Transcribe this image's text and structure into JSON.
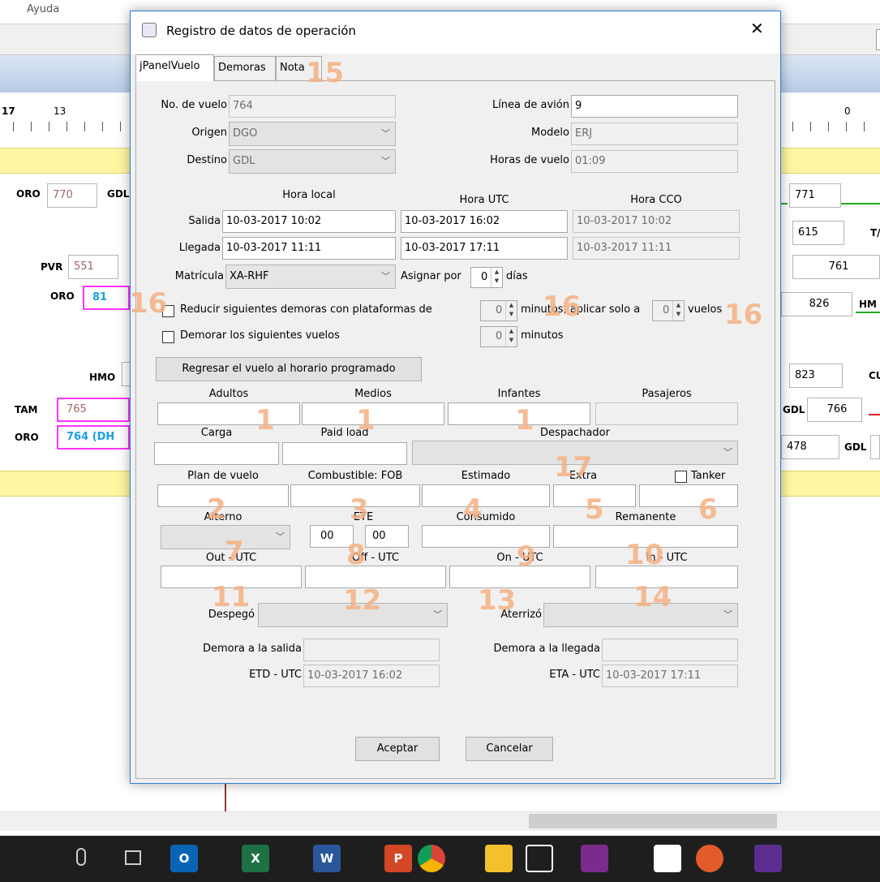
{
  "menu": {
    "help_label": "Ayuda"
  },
  "background": {
    "ruler": {
      "left_label": "17",
      "left_num": "13",
      "right_num": "0"
    },
    "left_rows": [
      {
        "code": "ORO",
        "num": "770",
        "dest": "GDL"
      },
      {
        "code": "PVR",
        "num": "551"
      },
      {
        "code": "ORO",
        "num": "81"
      },
      {
        "code": "HMO"
      },
      {
        "code": "TAM",
        "num": "765"
      },
      {
        "code": "ORO",
        "num": "764 (DH"
      }
    ],
    "right_rows": [
      {
        "num": "771"
      },
      {
        "num": "615",
        "code": "T/"
      },
      {
        "num": "761"
      },
      {
        "num": "826",
        "code": "HM"
      },
      {
        "num": "823",
        "code": "CU"
      },
      {
        "code": "GDL",
        "num": "766"
      },
      {
        "num": "478",
        "code": "GDL"
      }
    ]
  },
  "dialog": {
    "title": "Registro de datos de operación",
    "close_glyph": "✕",
    "tabs": [
      "jPanelVuelo",
      "Demoras",
      "Nota"
    ],
    "flight": {
      "flight_no_label": "No. de vuelo",
      "flight_no": "764",
      "origin_label": "Origen",
      "origin": "DGO",
      "dest_label": "Destino",
      "dest": "GDL",
      "airline_label": "Línea de avión",
      "airline": "9",
      "model_label": "Modelo",
      "model": "ERJ",
      "hours_label": "Horas de vuelo",
      "hours": "01:09"
    },
    "times": {
      "local_header": "Hora local",
      "utc_header": "Hora UTC",
      "cco_header": "Hora CCO",
      "dep_label": "Salida",
      "arr_label": "Llegada",
      "dep_local": "10-03-2017 10:02",
      "dep_utc": "10-03-2017 16:02",
      "dep_cco": "10-03-2017 10:02",
      "arr_local": "10-03-2017 11:11",
      "arr_utc": "10-03-2017 17:11",
      "arr_cco": "10-03-2017 11:11"
    },
    "plate_label": "Matrícula",
    "plate": "XA-RHF",
    "assign_label": "Asignar por",
    "assign_value": "0",
    "assign_unit": "días",
    "reduce_label": "Reducir siguientes demoras con plataformas de",
    "reduce_min": "0",
    "reduce_min_unit": "minutos, aplicar solo a",
    "reduce_flights": "0",
    "reduce_flights_unit": "vuelos",
    "delay_next_label": "Demorar los siguientes vuelos",
    "delay_min": "0",
    "delay_min_unit": "minutos",
    "revert_button": "Regresar el vuelo al horario programado",
    "pax": {
      "adults": "Adultos",
      "half": "Medios",
      "infants": "Infantes",
      "pax": "Pasajeros"
    },
    "cargo": {
      "cargo": "Carga",
      "paid": "Paid load",
      "dispatcher": "Despachador"
    },
    "fuel": {
      "plan": "Plan de vuelo",
      "fob": "Combustible: FOB",
      "est": "Estimado",
      "extra": "Extra",
      "tanker": "Tanker"
    },
    "alt": {
      "alt": "Alterno",
      "ete": "ETE",
      "ete_h": "00",
      "ete_m": "00",
      "consumed": "Consumido",
      "remaining": "Remanente"
    },
    "utc": {
      "out": "Out - UTC",
      "off": "Off - UTC",
      "on": "On - UTC",
      "in": "In - UTC"
    },
    "took_off_label": "Despegó",
    "landed_label": "Aterrizó",
    "dep_delay_label": "Demora a la salida",
    "arr_delay_label": "Demora a la llegada",
    "etd_label": "ETD - UTC",
    "etd": "10-03-2017 16:02",
    "eta_label": "ETA - UTC",
    "eta": "10-03-2017 17:11",
    "ok_button": "Aceptar",
    "cancel_button": "Cancelar",
    "annotations": [
      "15",
      "16",
      "16",
      "16",
      "1",
      "1",
      "1",
      "17",
      "2",
      "3",
      "4",
      "5",
      "6",
      "7",
      "8",
      "9",
      "10",
      "11",
      "12",
      "13",
      "14"
    ]
  },
  "taskbar": {
    "word": "W",
    "excel": "X",
    "ppt": "P",
    "outlook": "O"
  },
  "colors": {
    "accent": "#2f7fd6",
    "annotation": "#f4b183",
    "pink": "#ff33ff",
    "cyan": "#1aa0e6"
  }
}
